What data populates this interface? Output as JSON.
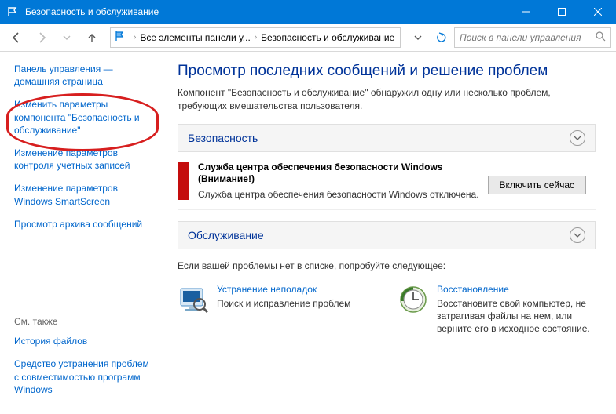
{
  "window": {
    "title": "Безопасность и обслуживание"
  },
  "breadcrumb": {
    "item1": "Все элементы панели у...",
    "item2": "Безопасность и обслуживание"
  },
  "search": {
    "placeholder": "Поиск в панели управления"
  },
  "sidebar": {
    "home": "Панель управления — домашняя страница",
    "change_settings": "Изменить параметры компонента \"Безопасность и обслуживание\"",
    "uac": "Изменение параметров контроля учетных записей",
    "smartscreen": "Изменение параметров Windows SmartScreen",
    "archive": "Просмотр архива сообщений",
    "see_also": "См. также",
    "file_history": "История файлов",
    "compat": "Средство устранения проблем с совместимостью программ Windows"
  },
  "main": {
    "heading": "Просмотр последних сообщений и решение проблем",
    "intro": "Компонент \"Безопасность и обслуживание\" обнаружил одну или несколько проблем, требующих вмешательства пользователя.",
    "section_security": "Безопасность",
    "section_maintenance": "Обслуживание",
    "alert": {
      "title": "Служба центра обеспечения безопасности Windows",
      "sub": "(Внимание!)",
      "text": "Служба центра обеспечения безопасности Windows отключена.",
      "button": "Включить сейчас"
    },
    "footer": "Если вашей проблемы нет в списке, попробуйте следующее:",
    "troubleshoot": {
      "link": "Устранение неполадок",
      "desc": "Поиск и исправление проблем"
    },
    "recovery": {
      "link": "Восстановление",
      "desc": "Восстановите свой компьютер, не затрагивая файлы на нем, или верните его в исходное состояние."
    }
  }
}
